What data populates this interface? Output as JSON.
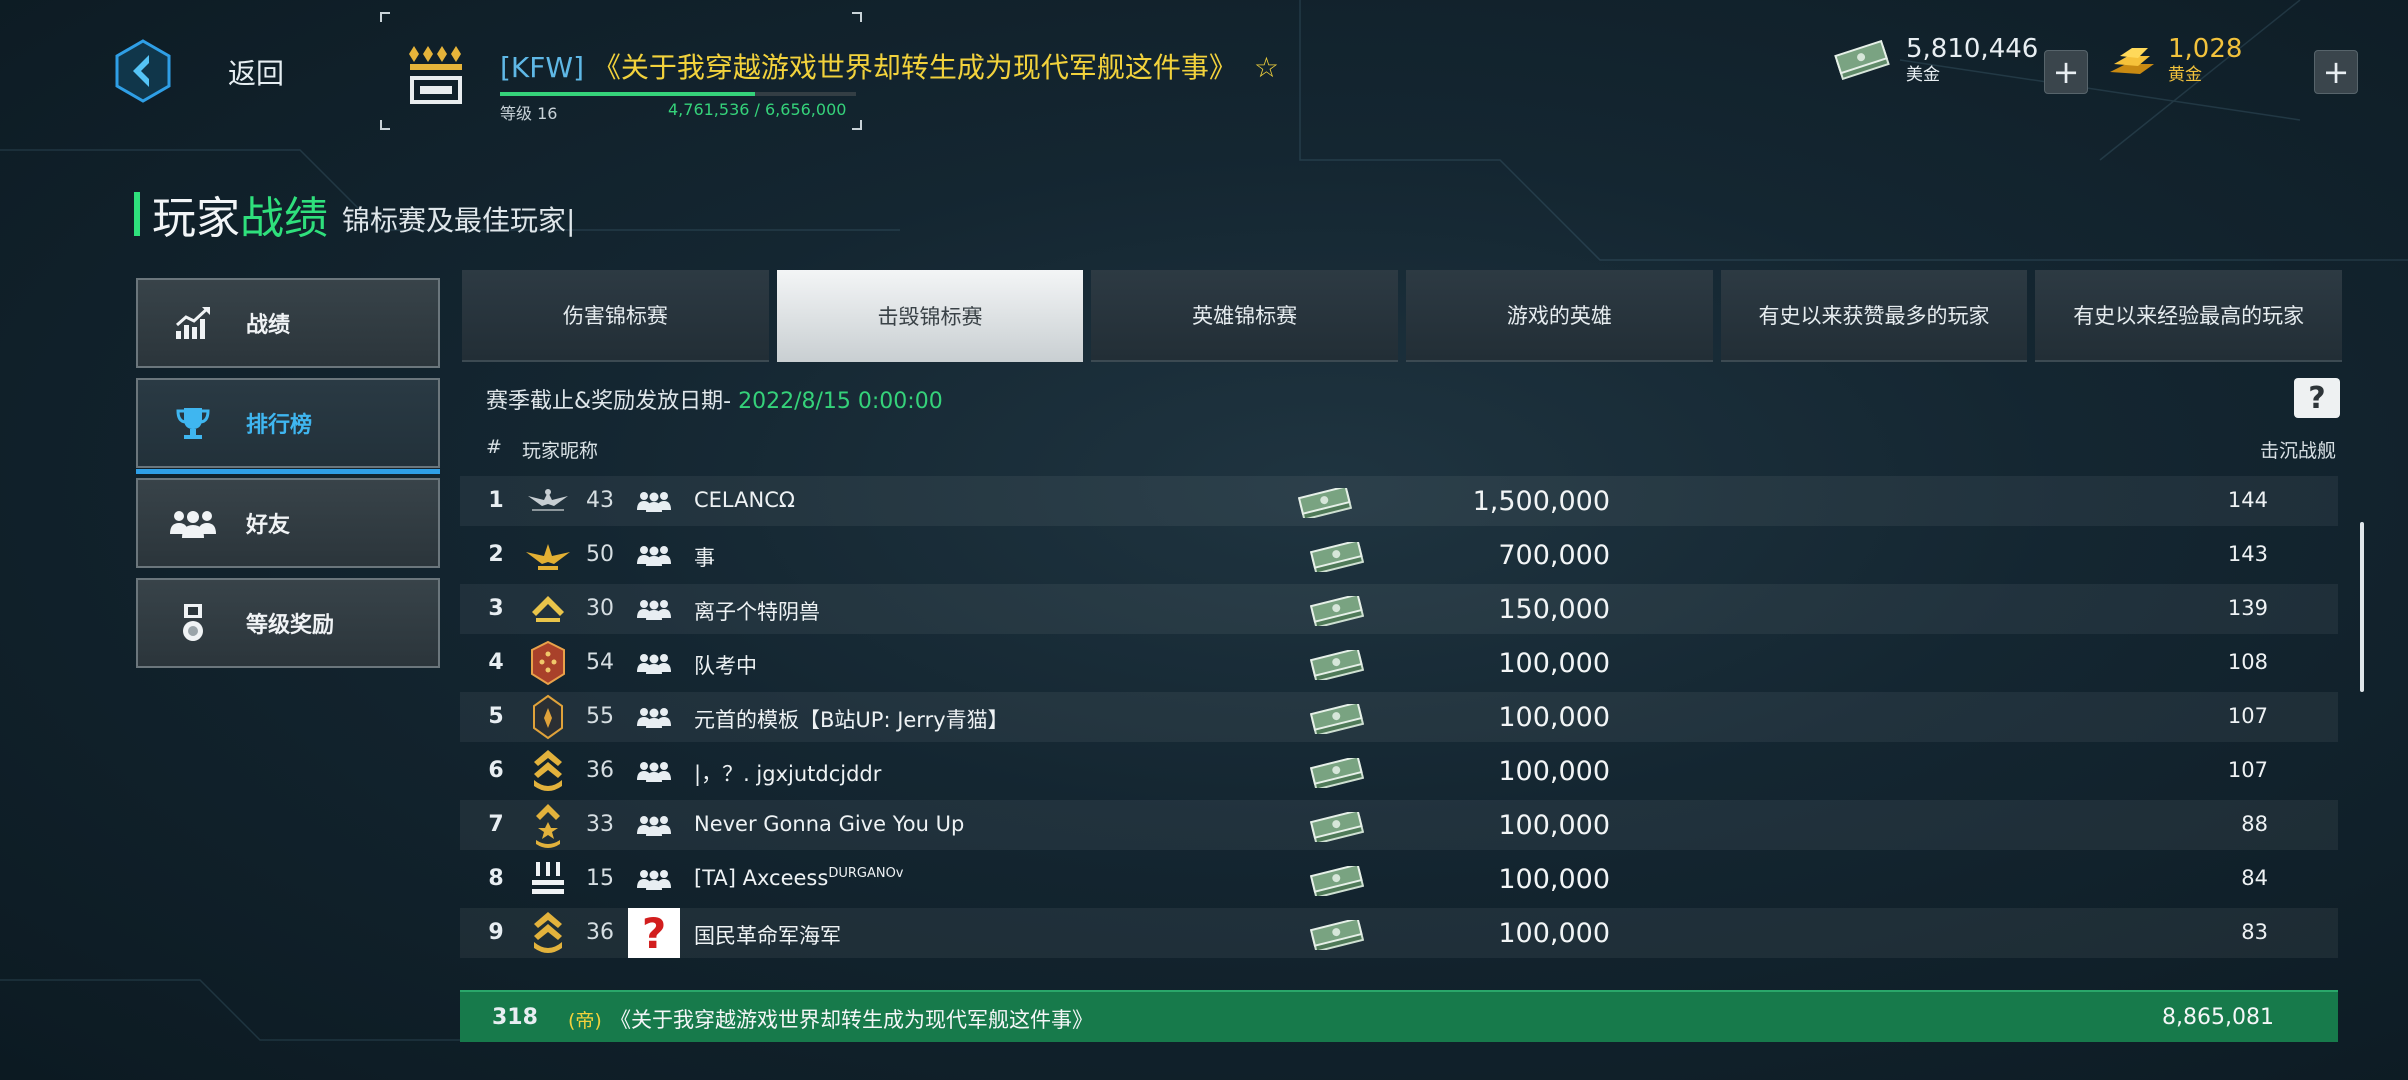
{
  "header": {
    "back_label": "返回",
    "clan_tag": "[KFW]",
    "player_name": "《关于我穿越游戏世界却转生成为现代军舰这件事》",
    "level_label": "等级 16",
    "xp_text": "4,761,536 / 6,656,000",
    "xp_progress": 0.7154,
    "money_amount": "5,810,446",
    "money_label": "美金",
    "gold_amount": "1,028",
    "gold_label": "黄金"
  },
  "heading": {
    "title_part1": "玩家",
    "title_part2": "战绩",
    "subtitle": "锦标赛及最佳玩家|"
  },
  "side_menu": [
    {
      "label": "战绩",
      "icon": "stats-chart-icon"
    },
    {
      "label": "排行榜",
      "icon": "trophy-icon"
    },
    {
      "label": "好友",
      "icon": "friends-icon"
    },
    {
      "label": "等级奖励",
      "icon": "medal-icon"
    }
  ],
  "tabs": [
    "伤害锦标赛",
    "击毁锦标赛",
    "英雄锦标赛",
    "游戏的英雄",
    "有史以来获赞最多的玩家",
    "有史以来经验最高的玩家"
  ],
  "deadline": {
    "label": "赛季截止&奖励发放日期- ",
    "datetime": "2022/8/15 0:00:00"
  },
  "help_label": "?",
  "table": {
    "col_rank": "#",
    "col_name": "玩家昵称",
    "col_kills": "击沉战舰",
    "rows": [
      {
        "rank": "1",
        "level": "43",
        "name": "CELANCΩ",
        "name_sup": "",
        "reward": "1,500,000",
        "kills": "144",
        "insignia": "eagle-insignia-icon"
      },
      {
        "rank": "2",
        "level": "50",
        "name": "事",
        "name_sup": "",
        "reward": "700,000",
        "kills": "143",
        "insignia": "gold-eagle-insignia-icon"
      },
      {
        "rank": "3",
        "level": "30",
        "name": "离子个特阴兽",
        "name_sup": "",
        "reward": "150,000",
        "kills": "139",
        "insignia": "chevron-insignia-icon"
      },
      {
        "rank": "4",
        "level": "54",
        "name": "队考中",
        "name_sup": "",
        "reward": "100,000",
        "kills": "108",
        "insignia": "red-shield-insignia-icon"
      },
      {
        "rank": "5",
        "level": "55",
        "name": "元首的模板【B站UP: Jerry青猫】",
        "name_sup": "",
        "reward": "100,000",
        "kills": "107",
        "insignia": "dark-shield-insignia-icon"
      },
      {
        "rank": "6",
        "level": "36",
        "name": "|，？. jgxjutdcjddr",
        "name_sup": "",
        "reward": "100,000",
        "kills": "107",
        "insignia": "stripes-insignia-icon"
      },
      {
        "rank": "7",
        "level": "33",
        "name": "Never Gonna Give You Up",
        "name_sup": "",
        "reward": "100,000",
        "kills": "88",
        "insignia": "star-chevron-insignia-icon"
      },
      {
        "rank": "8",
        "level": "15",
        "name": "[TA] Axceess",
        "name_sup": "DURGANOv",
        "reward": "100,000",
        "kills": "84",
        "insignia": "bars-insignia-icon"
      },
      {
        "rank": "9",
        "level": "36",
        "name": "国民革命军海军",
        "name_sup": "",
        "reward": "100,000",
        "kills": "83",
        "insignia": "stripes-insignia-icon"
      }
    ]
  },
  "my_row": {
    "rank": "318",
    "tag": "(帝)",
    "name": "《关于我穿越游戏世界却转生成为现代军舰这件事》",
    "value": "8,865,081"
  },
  "colors": {
    "accent_green": "#2fe07c",
    "accent_blue": "#3fb6f0",
    "gold_text": "#f2d23c",
    "my_row_bg": "#177a4b"
  }
}
